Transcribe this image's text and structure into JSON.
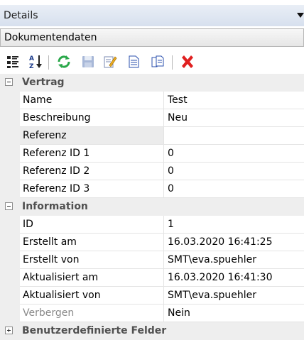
{
  "panel": {
    "title": "Details"
  },
  "dropdown": {
    "value": "Dokumentendaten"
  },
  "toolbar": {
    "icons": [
      "categorized-icon",
      "sort-alpha-icon",
      "refresh-icon",
      "save-icon",
      "edit-icon",
      "new-document-icon",
      "copy-document-icon",
      "delete-icon"
    ]
  },
  "categories": [
    {
      "label": "Vertrag",
      "expanded": true,
      "rows": [
        {
          "label": "Name",
          "value": "Test"
        },
        {
          "label": "Beschreibung",
          "value": "Neu"
        },
        {
          "label": "Referenz",
          "value": ""
        },
        {
          "label": "Referenz ID 1",
          "value": "0"
        },
        {
          "label": "Referenz ID 2",
          "value": "0"
        },
        {
          "label": "Referenz ID 3",
          "value": "0"
        }
      ]
    },
    {
      "label": "Information",
      "expanded": true,
      "rows": [
        {
          "label": "ID",
          "value": "1"
        },
        {
          "label": "Erstellt am",
          "value": "16.03.2020 16:41:25"
        },
        {
          "label": "Erstellt von",
          "value": "SMT\\eva.spuehler"
        },
        {
          "label": "Aktualisiert am",
          "value": "16.03.2020 16:41:30"
        },
        {
          "label": "Aktualisiert von",
          "value": "SMT\\eva.spuehler"
        },
        {
          "label": "Verbergen",
          "value": "Nein"
        }
      ]
    },
    {
      "label": "Benutzerdefinierte Felder",
      "expanded": false,
      "rows": []
    }
  ],
  "colors": {
    "header_bg": "#dde5f1",
    "category_bg": "#eeeeee",
    "delete_red": "#e02020",
    "refresh_green": "#2aa84a"
  }
}
